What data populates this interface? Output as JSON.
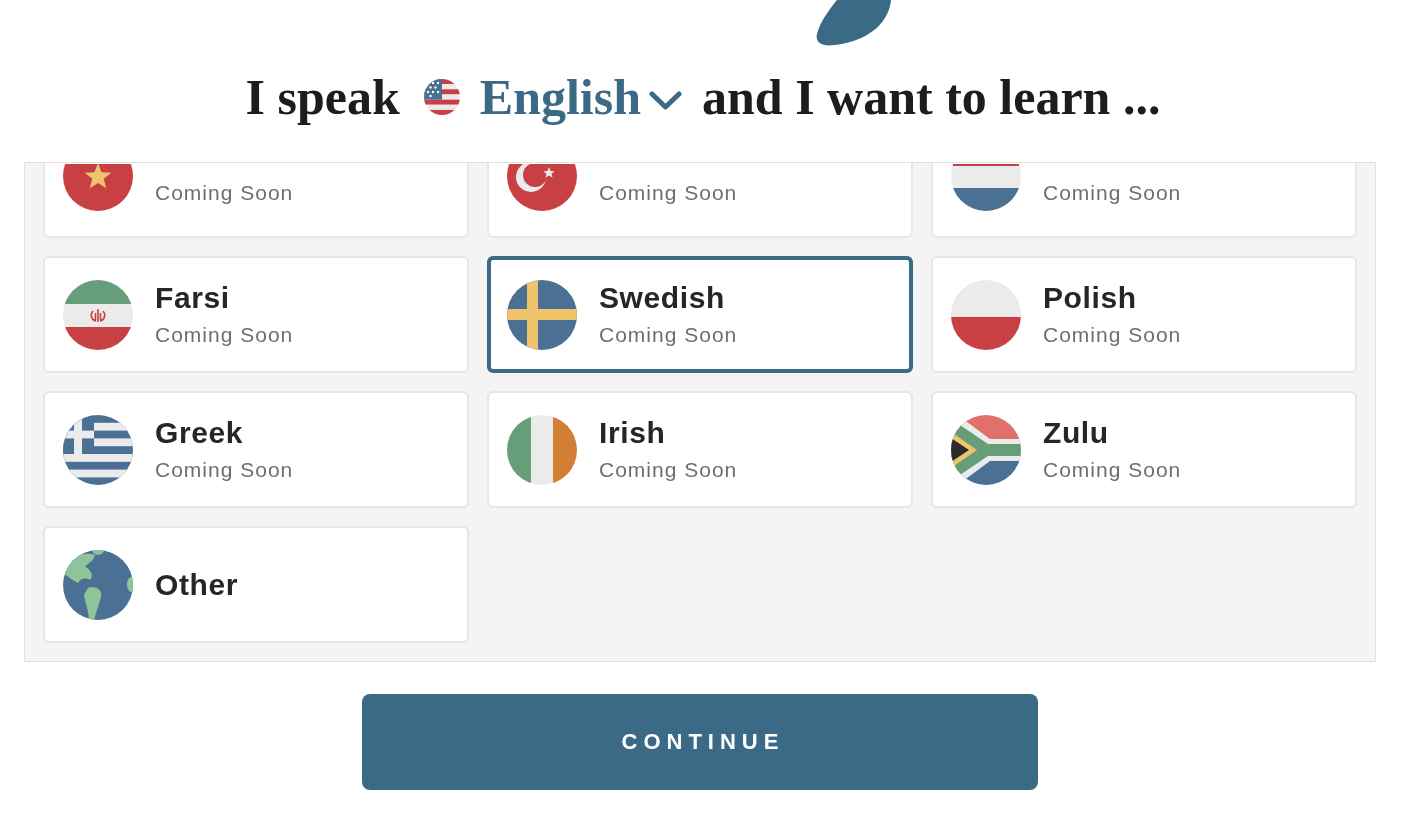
{
  "heading": {
    "prefix": "I speak",
    "native_language": "English",
    "suffix": "and I want to learn ..."
  },
  "languages": [
    {
      "status": "Coming Soon",
      "selected": false,
      "cut_off": true
    },
    {
      "status": "Coming Soon",
      "selected": false,
      "cut_off": true
    },
    {
      "status": "Coming Soon",
      "selected": false,
      "cut_off": true
    },
    {
      "name": "Farsi",
      "status": "Coming Soon",
      "selected": false,
      "cut_off": false
    },
    {
      "name": "Swedish",
      "status": "Coming Soon",
      "selected": true,
      "cut_off": false
    },
    {
      "name": "Polish",
      "status": "Coming Soon",
      "selected": false,
      "cut_off": false
    },
    {
      "name": "Greek",
      "status": "Coming Soon",
      "selected": false,
      "cut_off": false
    },
    {
      "name": "Irish",
      "status": "Coming Soon",
      "selected": false,
      "cut_off": false
    },
    {
      "name": "Zulu",
      "status": "Coming Soon",
      "selected": false,
      "cut_off": false
    },
    {
      "name": "Other",
      "selected": false,
      "cut_off": false
    }
  ],
  "continue_button": "CONTINUE"
}
